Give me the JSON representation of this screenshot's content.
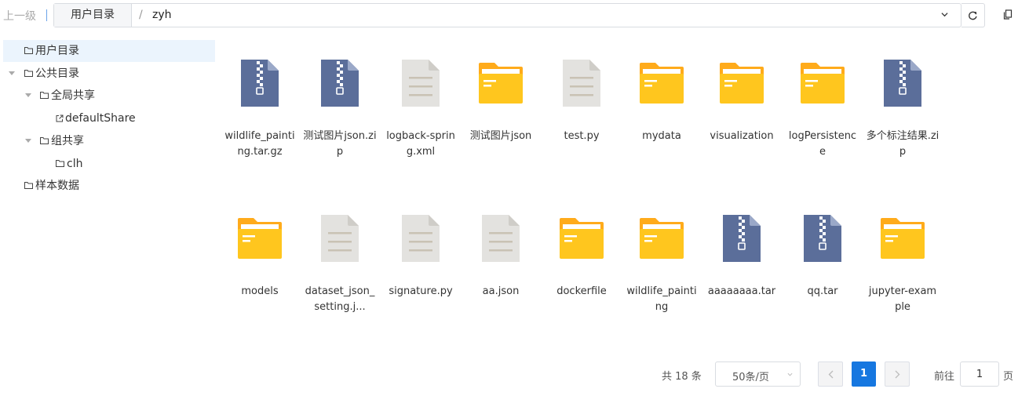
{
  "toolbar": {
    "up_label": "上一级",
    "home_crumb": "用户目录",
    "slash": "/",
    "current_folder": "zyh"
  },
  "tree": {
    "user_dir": "用户目录",
    "public_dir": "公共目录",
    "global_share": "全局共享",
    "default_share": "defaultShare",
    "group_share": "组共享",
    "group_clh": "clh",
    "sample_data": "样本数据"
  },
  "files": [
    {
      "name": "wildlife_painting.tar.gz",
      "icon": "zip-archive-icon"
    },
    {
      "name": "测试图片json.zip",
      "icon": "zip-archive-icon"
    },
    {
      "name": "logback-spring.xml",
      "icon": "document-icon"
    },
    {
      "name": "测试图片json",
      "icon": "folder-icon"
    },
    {
      "name": "test.py",
      "icon": "document-icon"
    },
    {
      "name": "mydata",
      "icon": "folder-icon"
    },
    {
      "name": "visualization",
      "icon": "folder-icon"
    },
    {
      "name": "logPersistence",
      "icon": "folder-icon"
    },
    {
      "name": "多个标注结果.zip",
      "icon": "zip-archive-icon"
    },
    {
      "name": "models",
      "icon": "folder-icon"
    },
    {
      "name": "dataset_json_setting.j...",
      "icon": "document-icon"
    },
    {
      "name": "signature.py",
      "icon": "document-icon"
    },
    {
      "name": "aa.json",
      "icon": "document-icon"
    },
    {
      "name": "dockerfile",
      "icon": "folder-icon"
    },
    {
      "name": "wildlife_painting",
      "icon": "folder-icon"
    },
    {
      "name": "aaaaaaaa.tar",
      "icon": "zip-archive-icon"
    },
    {
      "name": "qq.tar",
      "icon": "zip-archive-icon"
    },
    {
      "name": "jupyter-example",
      "icon": "folder-icon"
    }
  ],
  "pagination": {
    "total": "共 18 条",
    "page_size": "50条/页",
    "current_page": "1",
    "goto_label": "前往",
    "goto_value": "1",
    "page_unit": "页"
  },
  "colors": {
    "zip": "#5b6e9a",
    "folder": "#ffc61e",
    "folder_back": "#ffab1b",
    "document": "#e3e2df",
    "accent": "#1677e0",
    "tree_selected_bg": "#ebf4fd"
  }
}
